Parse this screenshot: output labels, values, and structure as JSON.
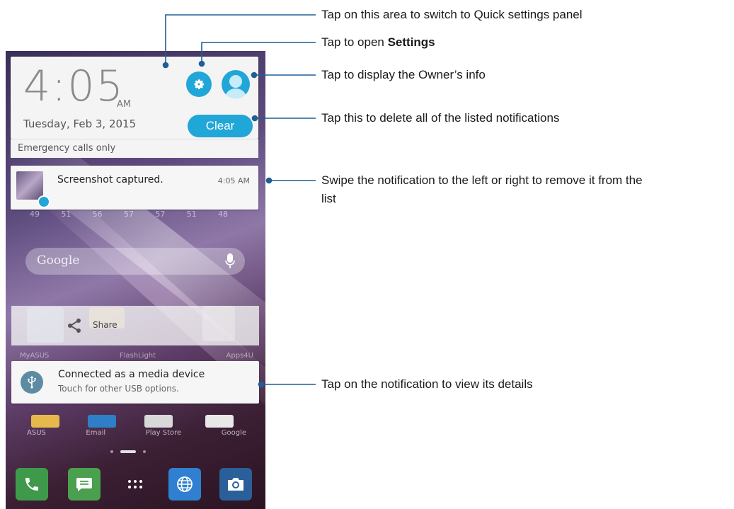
{
  "header": {
    "time": "4:05",
    "ampm": "AM",
    "date": "Tuesday, Feb 3, 2015",
    "clear_label": "Clear",
    "emergency": "Emergency calls only"
  },
  "notifications": {
    "screenshot": {
      "title": "Screenshot captured.",
      "time": "4:05 AM"
    },
    "usb": {
      "title": "Connected as a media device",
      "subtitle": "Touch for other USB options."
    }
  },
  "home": {
    "google_logo": "Google",
    "share_label": "Share",
    "weather_temps": [
      "49",
      "51",
      "56",
      "57",
      "57",
      "51",
      "48"
    ],
    "row1_apps": [
      "MyASUS",
      "FlashLight",
      "Apps4U"
    ],
    "row2_apps": [
      "ASUS",
      "Email",
      "Play Store",
      "Google"
    ]
  },
  "callouts": {
    "quick_settings": "Tap on this area to switch to Quick settings panel",
    "settings_prefix": "Tap to open ",
    "settings_bold": "Settings",
    "owner_info": "Tap to display the Owner’s info",
    "clear": "Tap this to delete all of the listed notifications",
    "swipe_line1": "Swipe the notification to the left or right to remove it from the",
    "swipe_line2": "list",
    "details": "Tap on the notification to view its details"
  },
  "colors": {
    "accent": "#21a6d8",
    "callout_line": "#1f5e96"
  },
  "icons": {
    "settings": "gear-icon",
    "owner": "avatar-icon",
    "usb": "usb-icon",
    "share": "share-icon",
    "mic": "mic-icon"
  }
}
